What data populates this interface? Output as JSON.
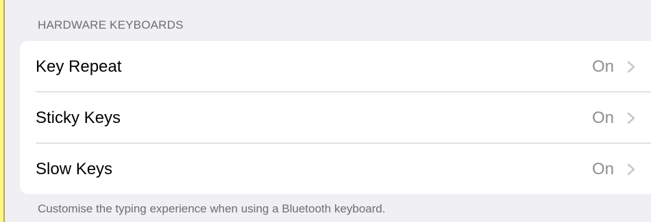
{
  "section": {
    "header": "HARDWARE KEYBOARDS",
    "footer": "Customise the typing experience when using a Bluetooth keyboard."
  },
  "rows": [
    {
      "label": "Key Repeat",
      "value": "On",
      "icon": "chevron-right-icon"
    },
    {
      "label": "Sticky Keys",
      "value": "On",
      "icon": "chevron-right-icon"
    },
    {
      "label": "Slow Keys",
      "value": "On",
      "icon": "chevron-right-icon"
    }
  ],
  "colors": {
    "page_background": "#fdf58a",
    "settings_background": "#efeff4",
    "cell_background": "#ffffff",
    "secondary_text": "#8e8e93",
    "header_text": "#6d6d72",
    "separator": "#c8c7cc"
  }
}
